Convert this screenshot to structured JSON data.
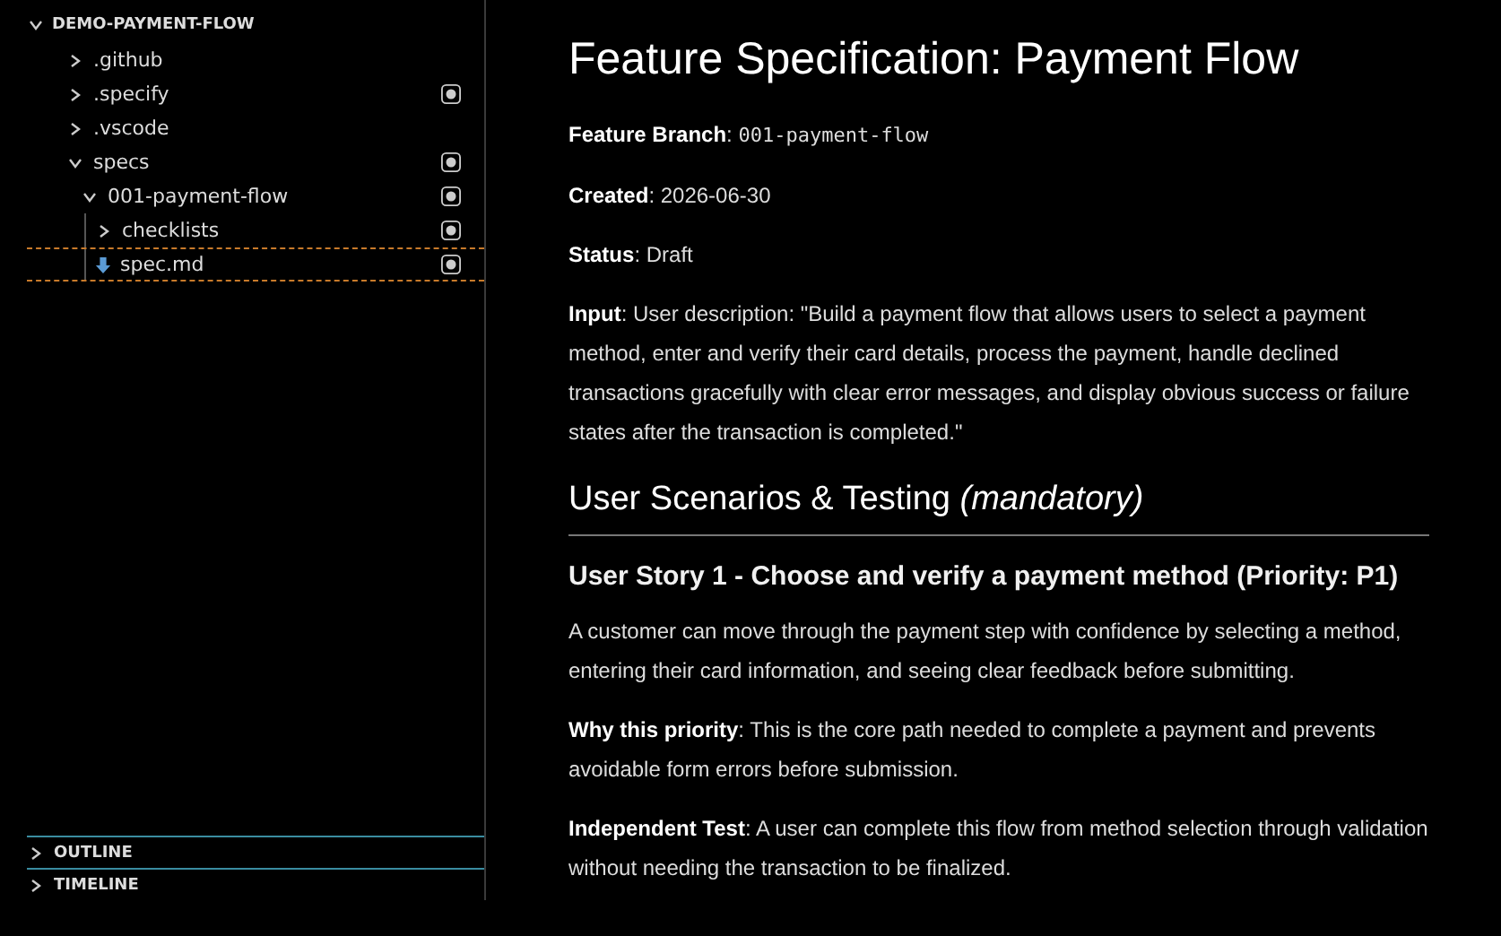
{
  "explorer": {
    "root": {
      "label": "DEMO-PAYMENT-FLOW",
      "expanded": true
    },
    "tree": [
      {
        "kind": "folder",
        "label": ".github",
        "expanded": false,
        "badge": false,
        "selected": false
      },
      {
        "kind": "folder",
        "label": ".specify",
        "expanded": false,
        "badge": true,
        "selected": false
      },
      {
        "kind": "folder",
        "label": ".vscode",
        "expanded": false,
        "badge": false,
        "selected": false
      },
      {
        "kind": "folder",
        "label": "specs",
        "expanded": true,
        "badge": true,
        "selected": false,
        "children": [
          {
            "kind": "folder",
            "label": "001-payment-flow",
            "expanded": true,
            "badge": true,
            "selected": false,
            "children": [
              {
                "kind": "folder",
                "label": "checklists",
                "expanded": false,
                "badge": true,
                "selected": false
              },
              {
                "kind": "file",
                "label": "spec.md",
                "badge": true,
                "selected": true
              }
            ]
          }
        ]
      }
    ]
  },
  "panels": [
    {
      "label": "OUTLINE",
      "expanded": false
    },
    {
      "label": "TIMELINE",
      "expanded": false
    }
  ],
  "document": [
    {
      "kind": "h1",
      "text": "Feature Specification: Payment Flow"
    },
    {
      "kind": "code_field",
      "label": "**Feature Branch**:",
      "value": "001-payment-flow"
    },
    {
      "kind": "para",
      "text": "**Created**: 2026-06-30"
    },
    {
      "kind": "para",
      "text": "**Status**: Draft"
    },
    {
      "kind": "para",
      "text": "**Input**: User description: \"Build a payment flow that allows users to select a payment method, enter and verify their card details, process the payment, handle declined transactions gracefully with clear error messages, and display obvious success or failure states after the transaction is completed.\""
    },
    {
      "kind": "h2",
      "text": "User Scenarios & Testing *(mandatory)*"
    },
    {
      "kind": "h3",
      "text": "User Story 1 - Choose and verify a payment method (Priority: P1)"
    },
    {
      "kind": "para",
      "text": "A customer can move through the payment step with confidence by selecting a method, entering their card information, and seeing clear feedback before submitting."
    },
    {
      "kind": "para",
      "text": "**Why this priority**: This is the core path needed to complete a payment and prevents avoidable form errors before submission."
    },
    {
      "kind": "para",
      "text": "**Independent Test**: A user can complete this flow from method selection through validation without needing the transaction to be finalized."
    }
  ]
}
